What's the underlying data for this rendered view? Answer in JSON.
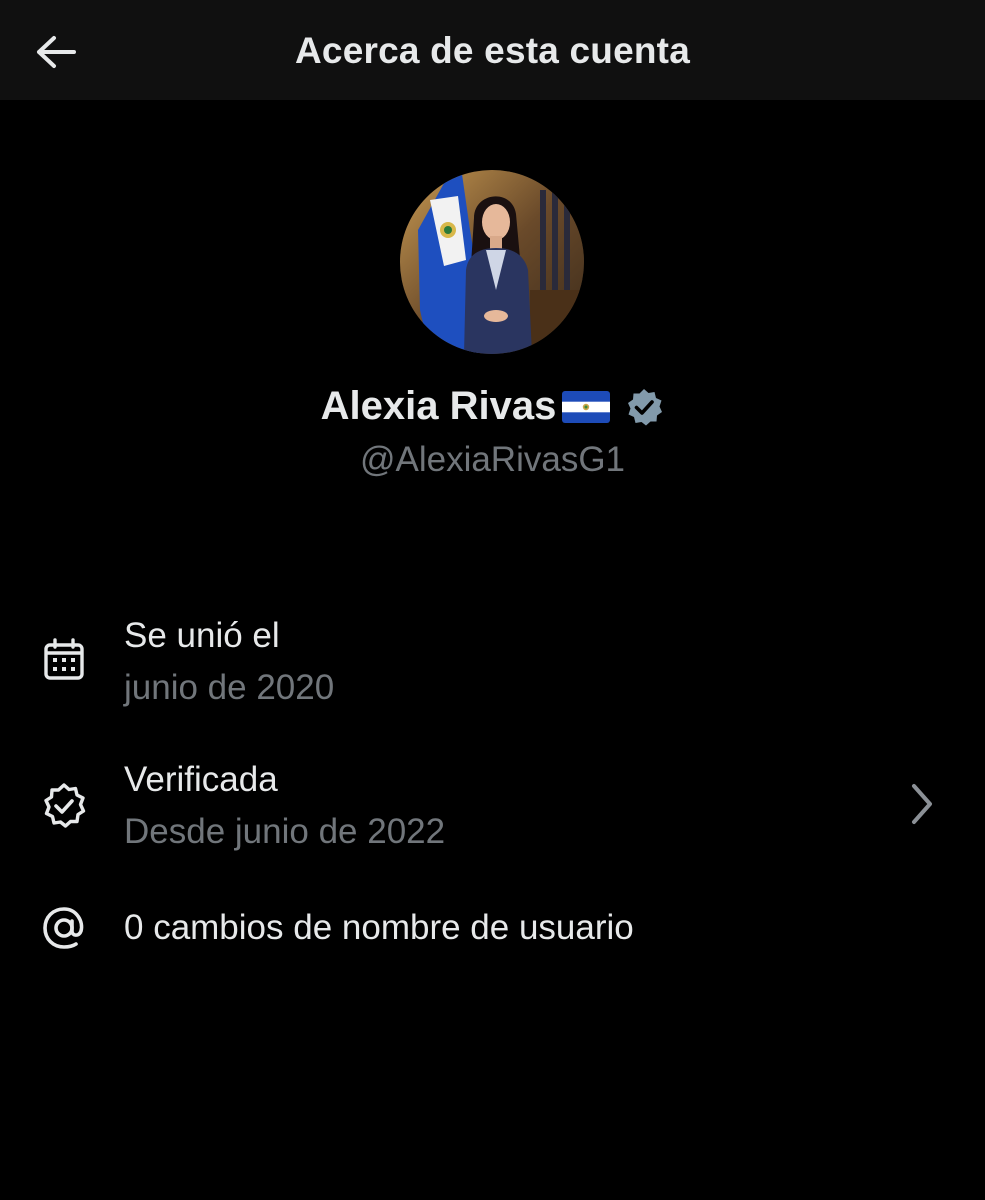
{
  "header": {
    "title": "Acerca de esta cuenta",
    "back_icon": "arrow-left-icon"
  },
  "profile": {
    "name": "Alexia Rivas",
    "flag_icon": "el-salvador-flag-icon",
    "verified_icon": "verified-badge-icon",
    "handle": "@AlexiaRivasG1",
    "colors": {
      "verified_badge": "#829aab",
      "handle": "#71767b"
    }
  },
  "details": {
    "joined": {
      "icon": "calendar-icon",
      "title": "Se unió el",
      "value": "junio de 2020"
    },
    "verified": {
      "icon": "verified-outline-icon",
      "title": "Verificada",
      "value": "Desde junio de 2022",
      "chevron_icon": "chevron-right-icon"
    },
    "username_changes": {
      "icon": "at-sign-icon",
      "text": "0 cambios de nombre de usuario"
    }
  },
  "colors": {
    "background": "#000000",
    "header_background": "#101010",
    "primary_text": "#e7e9ea",
    "secondary_text": "#71767b"
  }
}
